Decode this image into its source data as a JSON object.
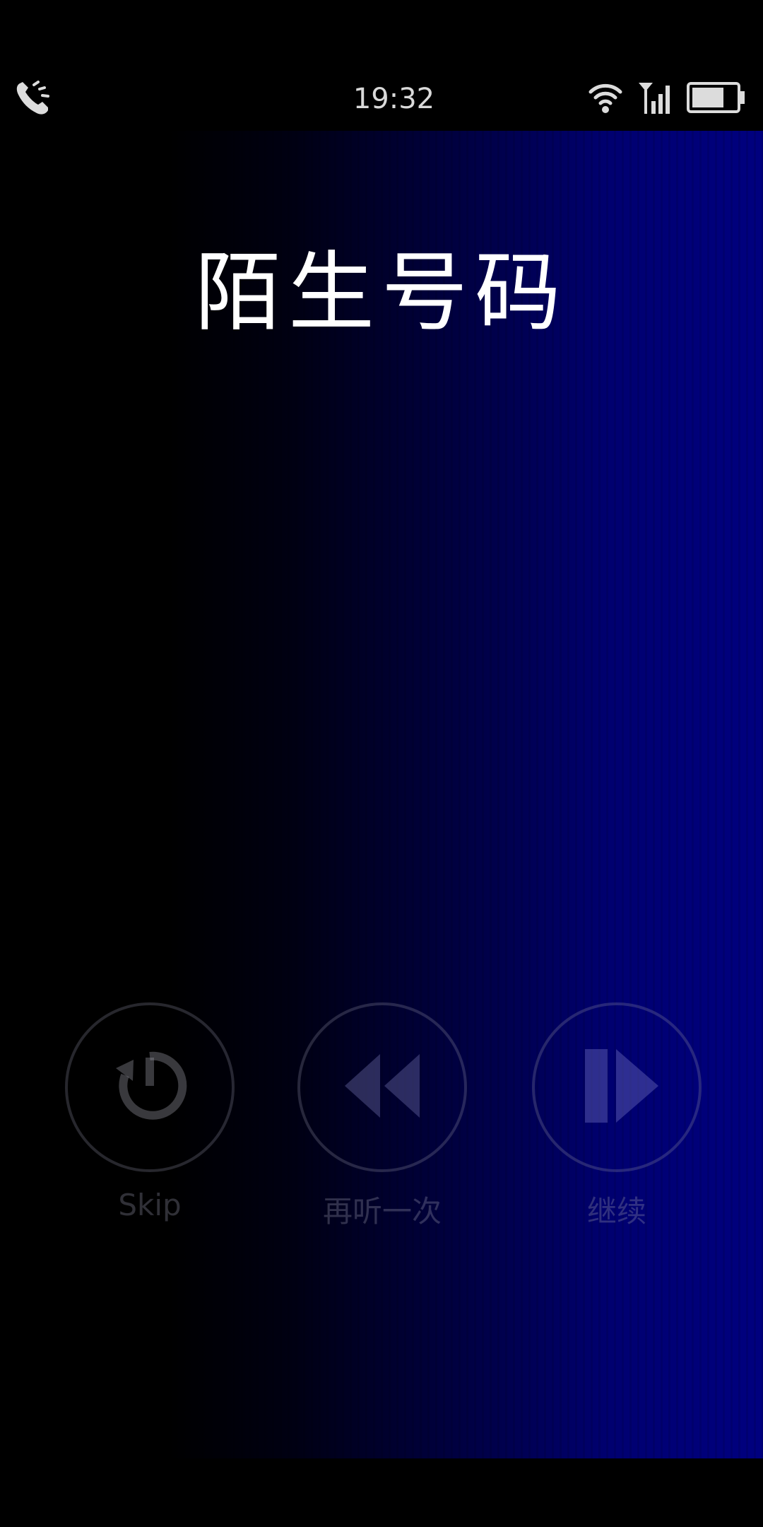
{
  "status_bar": {
    "time": "19:32",
    "icons": [
      "call-forward-icon",
      "wifi-icon",
      "signal-icon",
      "battery-icon"
    ]
  },
  "caller": {
    "title": "陌生号码"
  },
  "controls": {
    "skip_label": "Skip",
    "replay_label": "再听一次",
    "continue_label": "继续"
  },
  "colors": {
    "background_start": "#000000",
    "background_end": "#00007f",
    "title": "#ffffff"
  }
}
